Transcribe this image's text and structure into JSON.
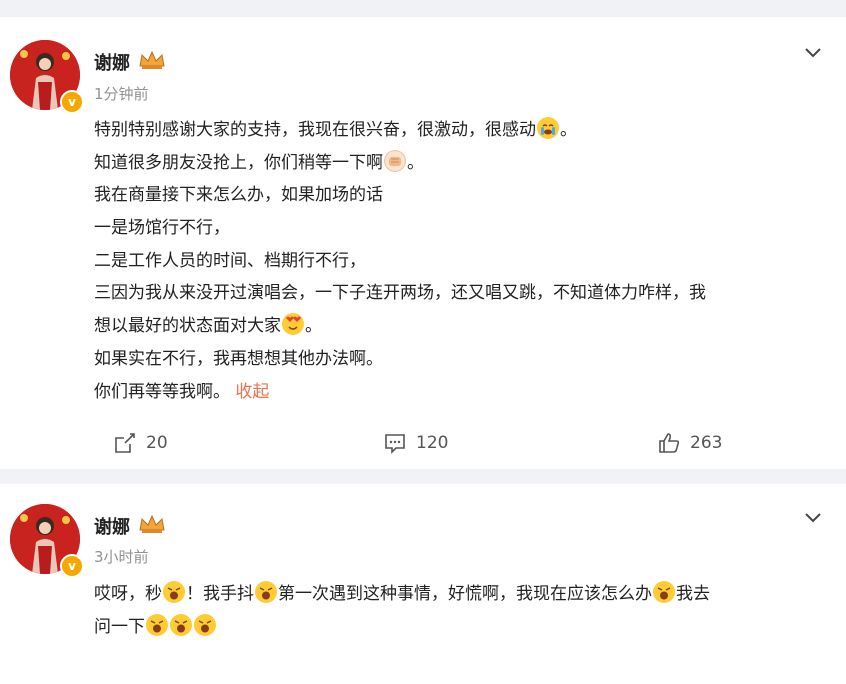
{
  "posts": [
    {
      "author": "谢娜",
      "time": "1分钟前",
      "lines": [
        "特别特别感谢大家的支持，我现在很兴奋，很激动，很感动",
        "知道很多朋友没抢上，你们稍等一下啊",
        "我在商量接下来怎么办，如果加场的话",
        "一是场馆行不行，",
        "二是工作人员的时间、档期行不行，",
        "三因为我从来没开过演唱会，一下子连开两场，还又唱又跳，不知道体力咋样，我",
        "想以最好的状态面对大家",
        "如果实在不行，我再想想其他办法啊。",
        "你们再等等我啊。"
      ],
      "line_suffix": {
        "end_period": "。"
      },
      "collapse_label": "收起",
      "reposts": "20",
      "comments": "120",
      "likes": "263",
      "icons": [
        "avatar",
        "verified-badge",
        "crown-badge",
        "chevron-down-icon",
        "cry-emoji",
        "fist-emoji",
        "love-emoji",
        "share-icon",
        "comment-icon",
        "like-icon"
      ]
    },
    {
      "author": "谢娜",
      "time": "3小时前",
      "text_a": "哎呀，秒",
      "text_b": "！我手抖",
      "text_c": "第一次遇到这种事情，好慌啊，我现在应该怎么办",
      "text_d": "我去",
      "text_e": "问一下",
      "icons": [
        "avatar",
        "verified-badge",
        "crown-badge",
        "chevron-down-icon",
        "wow-emoji"
      ]
    }
  ],
  "colors": {
    "background": "#f1f2f5",
    "card": "#ffffff",
    "collapse_link": "#eb7350",
    "timestamp": "#939393",
    "verified": "#f5a800"
  }
}
